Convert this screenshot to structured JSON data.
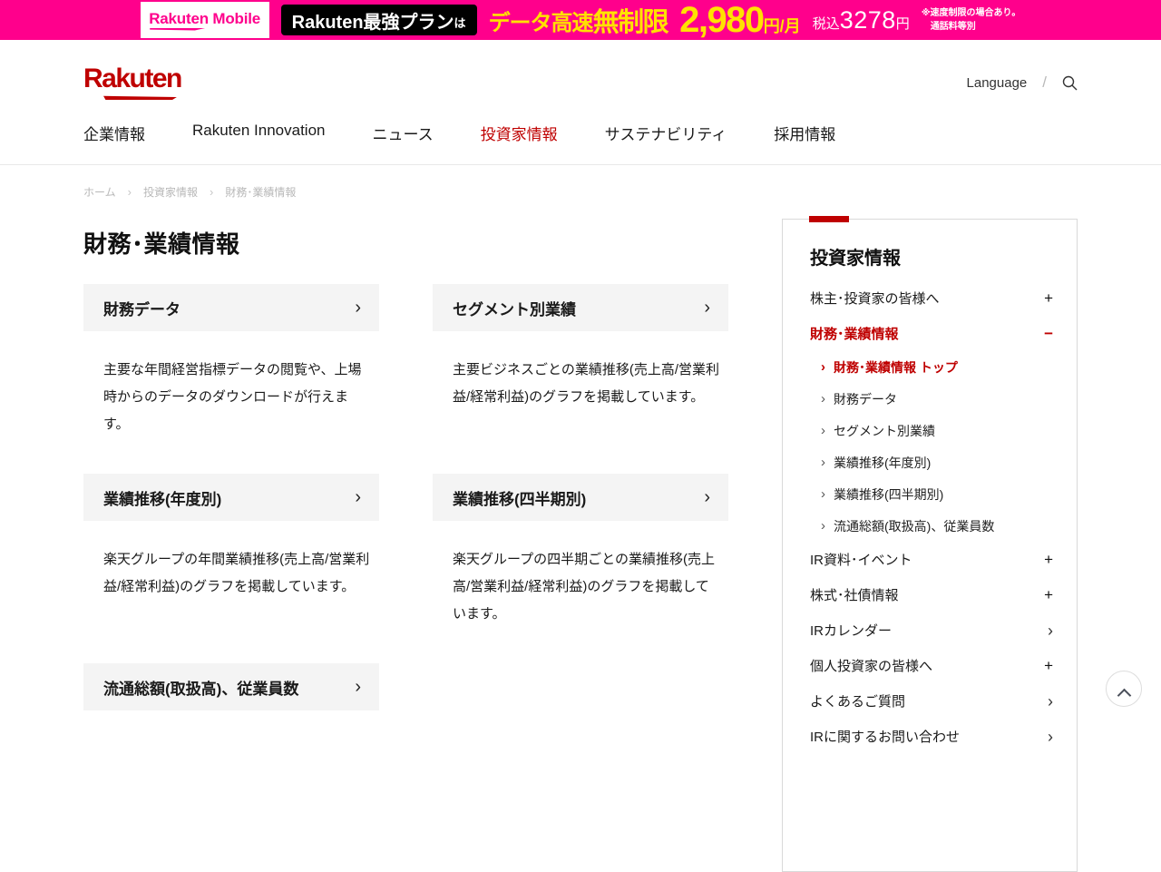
{
  "icons": {
    "plus": "+",
    "minus": "−",
    "chevron_right": "›"
  },
  "banner": {
    "mobile_logo": "Rakuten Mobile",
    "plan_label": "Rakuten最強プラン",
    "plan_particle": "は",
    "headline_lead": "データ高速",
    "headline_strong": "無制限",
    "price_amount": "2,980",
    "price_unit": "円/月",
    "tax_prefix": "税込",
    "tax_amount": "3278",
    "tax_suffix": "円",
    "note_line1": "※速度制限の場合あり。",
    "note_line2": "通話料等別"
  },
  "header": {
    "logo_text": "Rakuten",
    "language_label": "Language",
    "nav": [
      {
        "label": "企業情報",
        "active": false
      },
      {
        "label": "Rakuten Innovation",
        "active": false
      },
      {
        "label": "ニュース",
        "active": false
      },
      {
        "label": "投資家情報",
        "active": true
      },
      {
        "label": "サステナビリティ",
        "active": false
      },
      {
        "label": "採用情報",
        "active": false
      }
    ]
  },
  "breadcrumb": {
    "items": [
      "ホーム",
      "投資家情報",
      "財務･業績情報"
    ]
  },
  "page": {
    "title": "財務･業績情報"
  },
  "cards": [
    {
      "title": "財務データ",
      "description": "主要な年間経営指標データの閲覧や、上場時からのデータのダウンロードが行えます。"
    },
    {
      "title": "セグメント別業績",
      "description": "主要ビジネスごとの業績推移(売上高/営業利益/経常利益)のグラフを掲載しています。"
    },
    {
      "title": "業績推移(年度別)",
      "description": "楽天グループの年間業績推移(売上高/営業利益/経常利益)のグラフを掲載しています。"
    },
    {
      "title": "業績推移(四半期別)",
      "description": "楽天グループの四半期ごとの業績推移(売上高/営業利益/経常利益)のグラフを掲載しています。"
    },
    {
      "title": "流通総額(取扱高)、従業員数",
      "description": ""
    }
  ],
  "sidebar": {
    "title": "投資家情報",
    "item_shareholders": "株主･投資家の皆様へ",
    "item_financial": "財務･業績情報",
    "subitems": [
      {
        "label": "財務･業績情報 トップ",
        "active": true
      },
      {
        "label": "財務データ",
        "active": false
      },
      {
        "label": "セグメント別業績",
        "active": false
      },
      {
        "label": "業績推移(年度別)",
        "active": false
      },
      {
        "label": "業績推移(四半期別)",
        "active": false
      },
      {
        "label": "流通総額(取扱高)、従業員数",
        "active": false
      }
    ],
    "items_after": [
      {
        "label": "IR資料･イベント",
        "icon": "plus"
      },
      {
        "label": "株式･社債情報",
        "icon": "plus"
      },
      {
        "label": "IRカレンダー",
        "icon": "chevron"
      },
      {
        "label": "個人投資家の皆様へ",
        "icon": "plus"
      },
      {
        "label": "よくあるご質問",
        "icon": "chevron"
      },
      {
        "label": "IRに関するお問い合わせ",
        "icon": "chevron"
      }
    ]
  },
  "colors": {
    "brand_red": "#bf0000",
    "mobile_pink": "#ff008c",
    "banner_yellow": "#ffe100"
  }
}
